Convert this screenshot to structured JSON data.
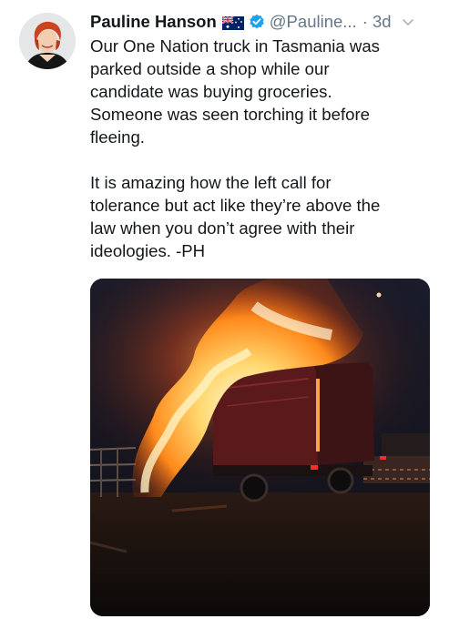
{
  "tweet": {
    "author_name": "Pauline Hanson",
    "handle": "@Pauline...",
    "separator": "·",
    "time": "3d",
    "paragraphs": [
      [
        "Our One Nation truck in Tasmania was",
        "parked outside a shop while our",
        "candidate was buying groceries.",
        "Someone was seen torching it before",
        "fleeing."
      ],
      [
        "It is amazing how the left call for",
        "tolerance but act like they’re above the",
        "law when you don’t agree with their",
        "ideologies. -PH"
      ]
    ]
  },
  "icons": {
    "flag": "australia-flag-icon",
    "verified": "verified-badge-icon",
    "menu": "chevron-down-icon"
  },
  "colors": {
    "text": "#14171a",
    "secondary": "#657786",
    "verified_blue": "#1da1f2"
  }
}
